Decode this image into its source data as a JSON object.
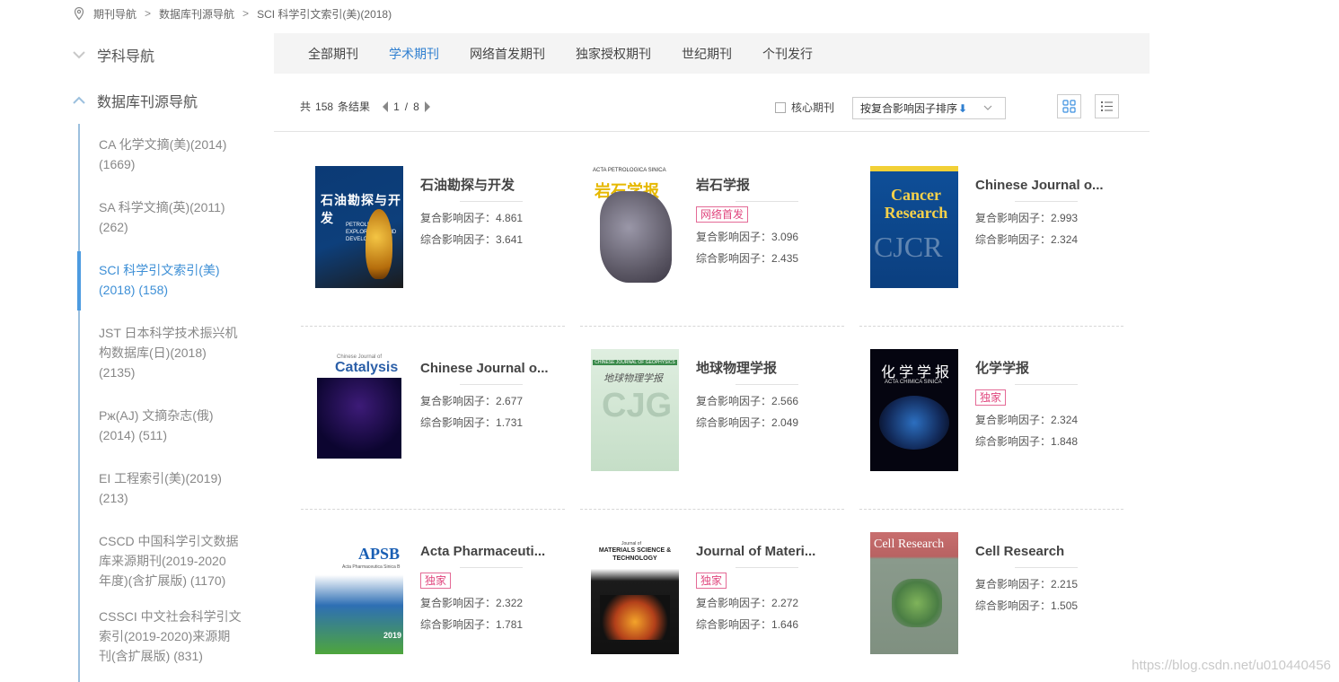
{
  "breadcrumb": {
    "items": [
      "期刊导航",
      "数据库刊源导航",
      "SCI 科学引文索引(美)(2018)"
    ],
    "separator": ">"
  },
  "nav": {
    "section1": "学科导航",
    "section2": "数据库刊源导航",
    "items": [
      {
        "line1": "CA 化学文摘(美)(2014)",
        "line2": "(1669)",
        "line3": ""
      },
      {
        "line1": "SA 科学文摘(英)(2011)",
        "line2": "(262)",
        "line3": ""
      },
      {
        "line1": "SCI 科学引文索引(美)",
        "line2": "(2018) (158)",
        "line3": ""
      },
      {
        "line1": "JST 日本科学技术振兴机",
        "line2": "构数据库(日)(2018)",
        "line3": "(2135)"
      },
      {
        "line1": "Рж(AJ) 文摘杂志(俄)",
        "line2": "(2014) (511)",
        "line3": ""
      },
      {
        "line1": "EI 工程索引(美)(2019)",
        "line2": "(213)",
        "line3": ""
      },
      {
        "line1": "CSCD 中国科学引文数据",
        "line2": "库来源期刊(2019-2020",
        "line3": "年度)(含扩展版) (1170)"
      },
      {
        "line1": "CSSCI 中文社会科学引文",
        "line2": "索引(2019-2020)来源期",
        "line3": "刊(含扩展版) (831)"
      }
    ]
  },
  "tabs": [
    "全部期刊",
    "学术期刊",
    "网络首发期刊",
    "独家授权期刊",
    "世纪期刊",
    "个刊发行"
  ],
  "toolbar": {
    "result_prefix": "共",
    "result_count": "158",
    "result_suffix": "条结果",
    "page_current": "1",
    "page_sep": "/",
    "page_total": "8",
    "core_label": "核心期刊",
    "sort_label": "按复合影响因子排序",
    "sort_arrow": "⬇"
  },
  "labels": {
    "composite": "复合影响因子：",
    "comprehensive": "综合影响因子："
  },
  "journals": [
    {
      "title": "石油勘探与开发",
      "tag": "",
      "composite": "4.861",
      "comprehensive": "3.641",
      "cover_text": "石油勘探与开发",
      "cover_sub": "PETROLEUM EXPLORATION AND DEVELOPMENT"
    },
    {
      "title": "岩石学报",
      "tag": "网络首发",
      "composite": "3.096",
      "comprehensive": "2.435",
      "cover_text": "岩石学报",
      "cover_sub": "ACTA PETROLOGICA SINICA"
    },
    {
      "title": "Chinese Journal o...",
      "tag": "",
      "composite": "2.993",
      "comprehensive": "2.324",
      "cover_text": "Cancer Research",
      "cover_sub": "CJCR"
    },
    {
      "title": "Chinese Journal o...",
      "tag": "",
      "composite": "2.677",
      "comprehensive": "1.731",
      "cover_text": "Catalysis",
      "cover_sub": "Chinese Journal of"
    },
    {
      "title": "地球物理学报",
      "tag": "",
      "composite": "2.566",
      "comprehensive": "2.049",
      "cover_text": "地球物理学报",
      "cover_sub": "CHINESE JOURNAL OF GEOPHYSICS"
    },
    {
      "title": "化学学报",
      "tag": "独家",
      "composite": "2.324",
      "comprehensive": "1.848",
      "cover_text": "化学学报",
      "cover_sub": "ACTA CHIMICA SINICA"
    },
    {
      "title": "Acta Pharmaceuti...",
      "tag": "独家",
      "composite": "2.322",
      "comprehensive": "1.781",
      "cover_text": "APSB",
      "cover_sub": "Acta Pharmaceutica Sinica B"
    },
    {
      "title": "Journal of Materi...",
      "tag": "独家",
      "composite": "2.272",
      "comprehensive": "1.646",
      "cover_text": "MATERIALS SCIENCE & TECHNOLOGY",
      "cover_sub": "Journal of"
    },
    {
      "title": "Cell Research",
      "tag": "",
      "composite": "2.215",
      "comprehensive": "1.505",
      "cover_text": "Cell Research",
      "cover_sub": ""
    }
  ],
  "watermark": "https://blog.csdn.net/u010440456",
  "colors": {
    "accent": "#2f7fd0",
    "tag": "#e0457d",
    "nav_active": "#3d8fd6"
  }
}
